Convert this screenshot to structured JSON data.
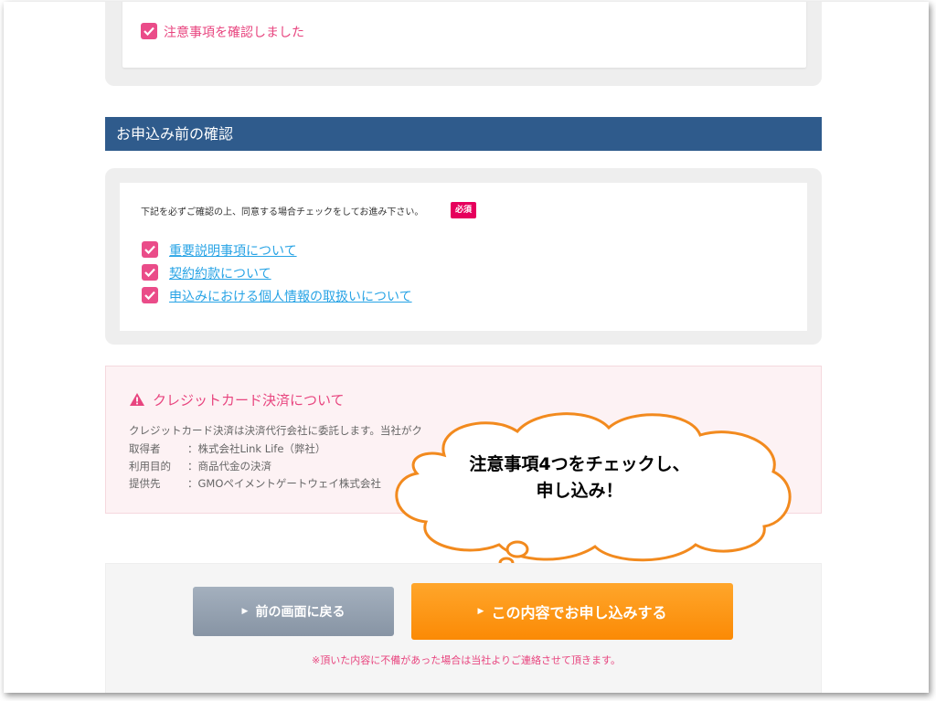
{
  "notice": {
    "checkbox_label": "注意事項を確認しました"
  },
  "confirmation": {
    "header": "お申込み前の確認",
    "instruction": "下記を必ずご確認の上、同意する場合チェックをしてお進み下さい。",
    "required_badge": "必須",
    "items": [
      {
        "label": "重要説明事項について"
      },
      {
        "label": "契約約款について"
      },
      {
        "label": "申込みにおける個人情報の取扱いについて"
      }
    ]
  },
  "credit_card": {
    "title": "クレジットカード決済について",
    "description": "クレジットカード決済は決済代行会社に委託します。当社がク",
    "rows": [
      {
        "label": "取得者",
        "value": "：株式会社Link Life（弊社）"
      },
      {
        "label": "利用目的",
        "value": "：商品代金の決済"
      },
      {
        "label": "提供先",
        "value": "：GMOペイメントゲートウェイ株式会社"
      }
    ]
  },
  "buttons": {
    "back_label": "前の画面に戻る",
    "submit_label": "この内容でお申し込みする"
  },
  "footnote": "※頂いた内容に不備があった場合は当社よりご連絡させて頂きます。",
  "callout": {
    "line1": "注意事項4つをチェックし、",
    "line2": "申し込み！"
  },
  "colors": {
    "header_bg": "#2f5b8c",
    "checkbox": "#ea4c89",
    "link": "#27a3e5",
    "accent_pink": "#e8457f",
    "submit_orange": "#fb8a05",
    "back_gray": "#8794a4"
  }
}
